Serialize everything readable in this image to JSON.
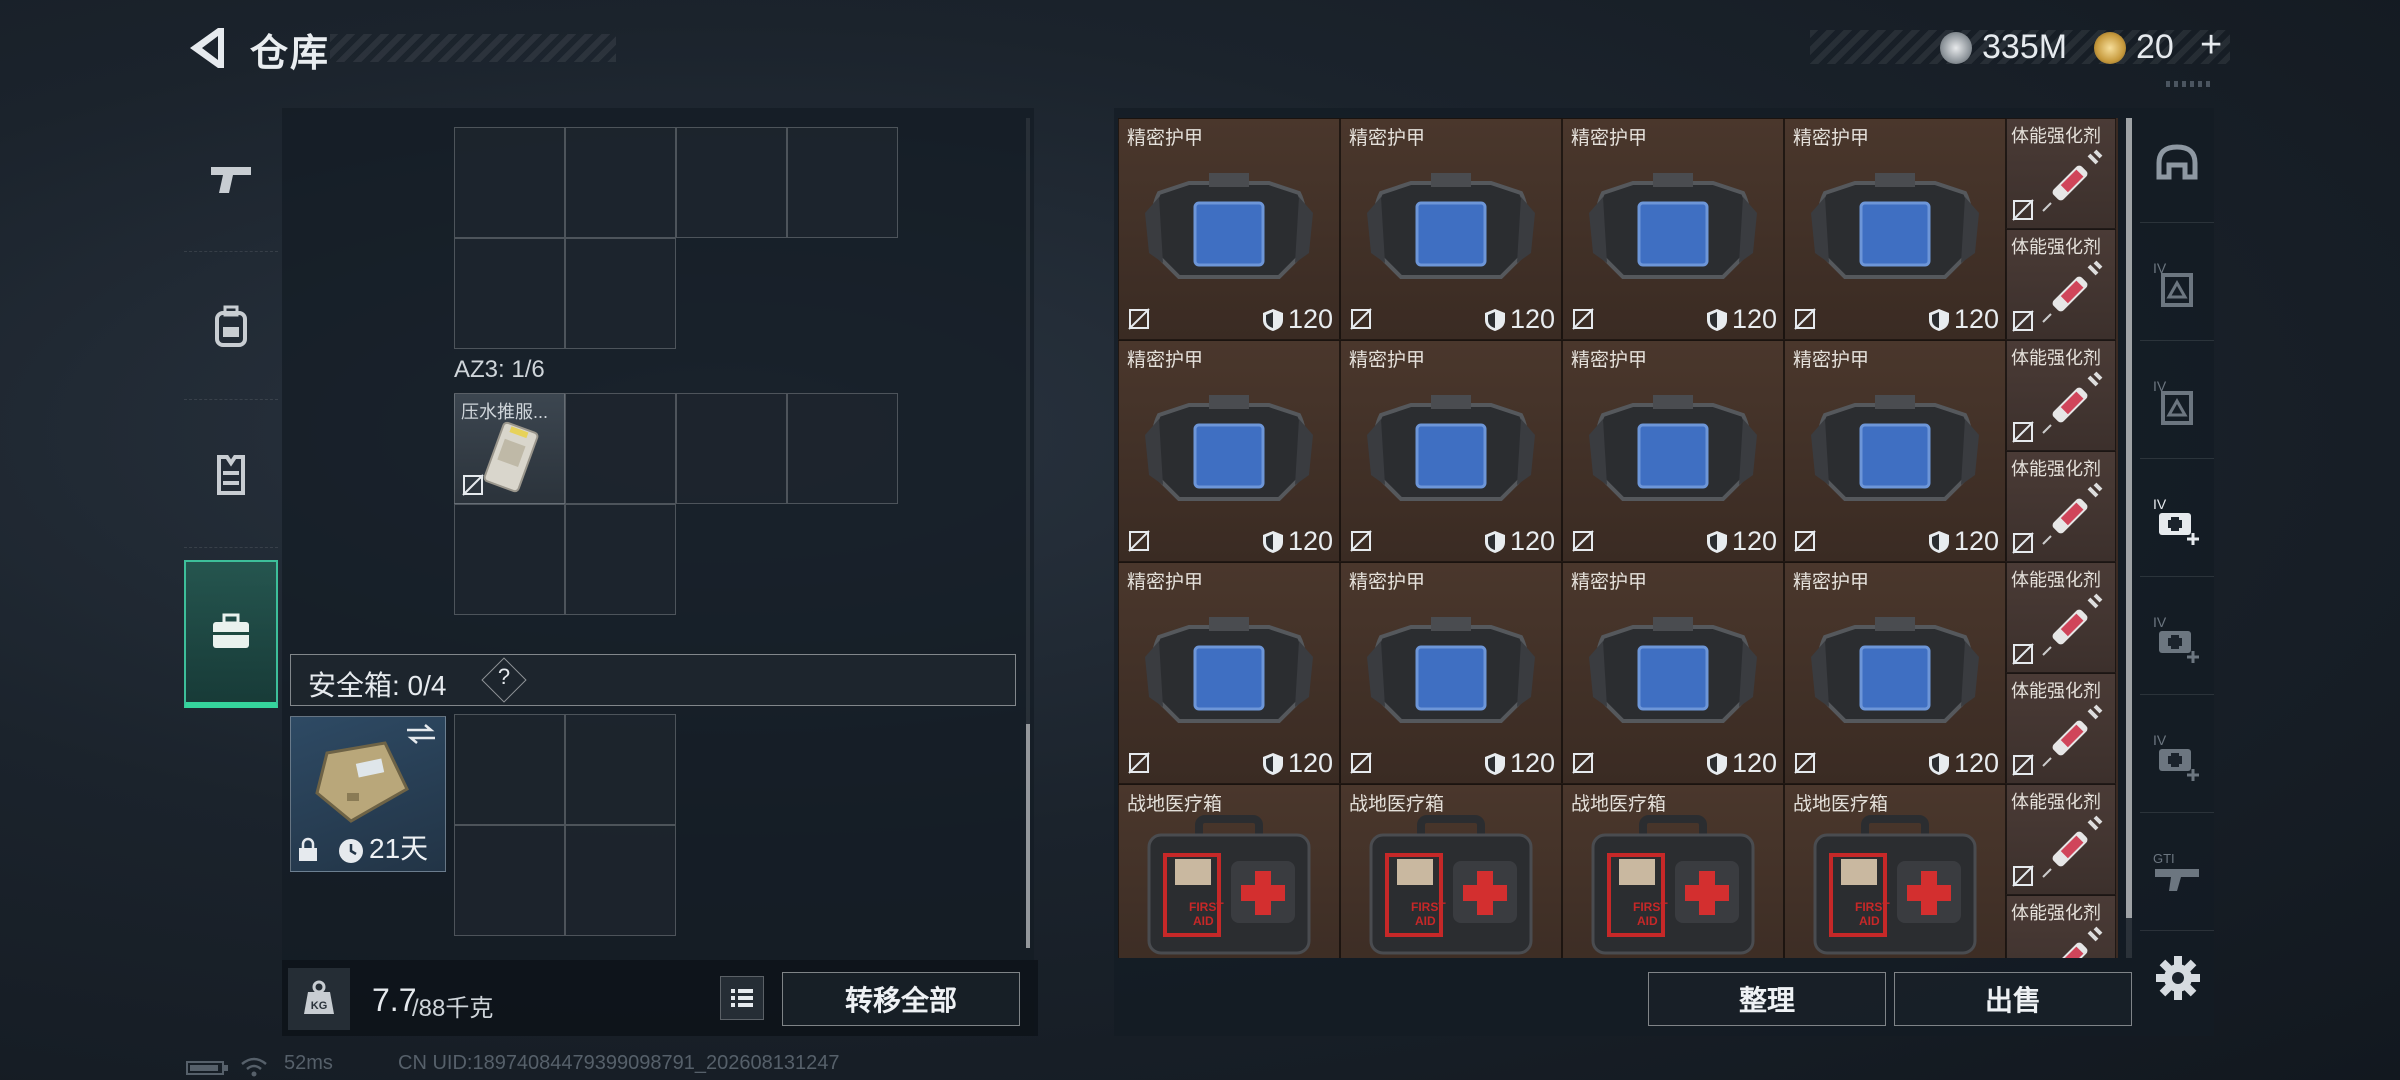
{
  "header": {
    "title": "仓库",
    "currency": [
      {
        "icon": "silver-coin-icon",
        "value": "335M"
      },
      {
        "icon": "gold-coin-icon",
        "value": "20"
      }
    ],
    "plus": "+"
  },
  "left": {
    "categories": [
      {
        "icon": "pistol-icon",
        "active": false
      },
      {
        "icon": "backpack-icon",
        "active": false
      },
      {
        "icon": "vest-icon",
        "active": false
      },
      {
        "icon": "toolbox-icon",
        "active": true
      }
    ],
    "container_label": "AZ3: 1/6",
    "container_item": "压水推服...",
    "safebox_label": "安全箱:  0/4",
    "safebox_help": "?",
    "safebox_timer": "21天",
    "weight_value": "7.7",
    "weight_max": "/88千克",
    "transfer_all": "转移全部"
  },
  "warehouse": {
    "rows": [
      {
        "items": [
          {
            "name": "精密护甲",
            "durability": "120"
          },
          {
            "name": "精密护甲",
            "durability": "120"
          },
          {
            "name": "精密护甲",
            "durability": "120"
          },
          {
            "name": "精密护甲",
            "durability": "120"
          }
        ]
      },
      {
        "items": [
          {
            "name": "精密护甲",
            "durability": "120"
          },
          {
            "name": "精密护甲",
            "durability": "120"
          },
          {
            "name": "精密护甲",
            "durability": "120"
          },
          {
            "name": "精密护甲",
            "durability": "120"
          }
        ]
      },
      {
        "items": [
          {
            "name": "精密护甲",
            "durability": "120"
          },
          {
            "name": "精密护甲",
            "durability": "120"
          },
          {
            "name": "精密护甲",
            "durability": "120"
          },
          {
            "name": "精密护甲",
            "durability": "120"
          }
        ]
      },
      {
        "items": [
          {
            "name": "战地医疗箱"
          },
          {
            "name": "战地医疗箱"
          },
          {
            "name": "战地医疗箱"
          },
          {
            "name": "战地医疗箱"
          }
        ]
      }
    ],
    "side_items": [
      "体能强化剂",
      "体能强化剂",
      "体能强化剂",
      "体能强化剂",
      "体能强化剂",
      "体能强化剂",
      "体能强化剂",
      "体能强化剂"
    ],
    "sort": "整理",
    "sell": "出售"
  },
  "storage_tabs": [
    {
      "icon": "helmet-icon"
    },
    {
      "icon": "armor-iv-icon"
    },
    {
      "icon": "armor-iv-icon"
    },
    {
      "icon": "medkit-iv-plus-icon"
    },
    {
      "icon": "medkit-iv-plus-icon"
    },
    {
      "icon": "medkit-iv-plus-icon"
    },
    {
      "icon": "gti-gun-icon"
    }
  ],
  "status": {
    "ping": "52ms",
    "uid": "CN UID:18974084479399098791_202608131247"
  }
}
